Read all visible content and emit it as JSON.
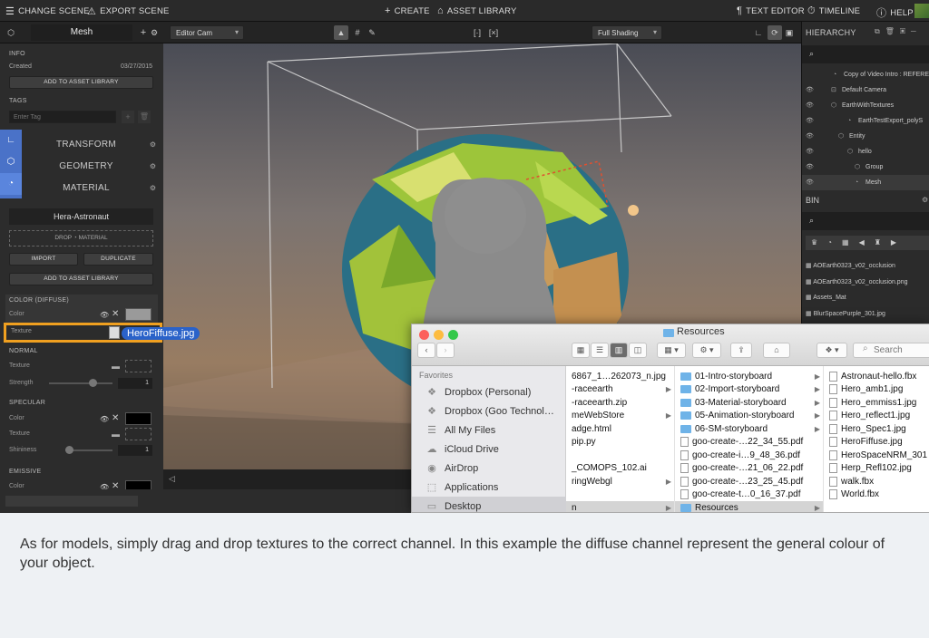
{
  "topbar": {
    "change_scene": "CHANGE SCENE",
    "export_scene": "EXPORT SCENE",
    "create": "CREATE",
    "asset_library": "ASSET LIBRARY",
    "text_editor": "TEXT EDITOR",
    "timeline": "TIMELINE",
    "help": "HELP"
  },
  "toolbar": {
    "entity_name": "Mesh",
    "camera_select": "Editor Cam",
    "shading_select": "Full Shading"
  },
  "inspector": {
    "info_title": "INFO",
    "created_label": "Created",
    "created_value": "03/27/2015",
    "add_asset_label": "ADD TO ASSET LIBRARY",
    "tags_title": "TAGS",
    "tag_placeholder": "Enter Tag",
    "transform": "TRANSFORM",
    "geometry": "GEOMETRY",
    "material": "MATERIAL",
    "material_name": "Hera-Astronaut",
    "drop_material": "DROP",
    "drop_material_suffix": "MATERIAL",
    "import": "IMPORT",
    "duplicate": "DUPLICATE",
    "add_asset_label2": "ADD TO ASSET LIBRARY",
    "color_diffuse": "COLOR (DIFFUSE)",
    "color": "Color",
    "texture": "Texture",
    "normal": "NORMAL",
    "normal_texture": "Texture",
    "strength": "Strength",
    "strength_value": "1",
    "specular": "SPECULAR",
    "spec_color": "Color",
    "spec_texture": "Texture",
    "shininess": "Shininess",
    "shininess_value": "1",
    "emissive": "EMISSIVE",
    "emissive_color": "Color"
  },
  "drag": {
    "file": "HeroFiffuse.jpg"
  },
  "hierarchy": {
    "title": "HIERARCHY",
    "items": [
      "Copy of Video Intro : REFERE",
      "Default Camera",
      "EarthWithTextures",
      "EarthTestExport_polyS",
      "Entity",
      "hello",
      "Group",
      "Mesh"
    ]
  },
  "bin": {
    "title": "BIN",
    "items": [
      "AOEarth0323_v02_occlusion",
      "AOEarth0323_v02_occlusion.png",
      "Assets_Mat",
      "BlurSpacePurple_301.jpg"
    ]
  },
  "finder": {
    "title": "Resources",
    "search_placeholder": "Search",
    "favorites_title": "Favorites",
    "sidebar": [
      "Dropbox (Personal)",
      "Dropbox (Goo Technol…",
      "All My Files",
      "iCloud Drive",
      "AirDrop",
      "Applications",
      "Desktop"
    ],
    "col1": [
      "6867_1…262073_n.jpg",
      "-raceearth",
      "-raceearth.zip",
      "meWebStore",
      "adge.html",
      "pip.py",
      "",
      "_COMOPS_102.ai",
      "ringWebgl",
      "",
      "n"
    ],
    "col2": [
      "01-Intro-storyboard",
      "02-Import-storyboard",
      "03-Material-storyboard",
      "05-Animation-storyboard",
      "06-SM-storyboard",
      "goo-create-…22_34_55.pdf",
      "goo-create-i…9_48_36.pdf",
      "goo-create-…21_06_22.pdf",
      "goo-create-…23_25_45.pdf",
      "goo-create-t…0_16_37.pdf",
      "Resources"
    ],
    "col3": [
      "Astronaut-hello.fbx",
      "Hero_amb1.jpg",
      "Hero_emmiss1.jpg",
      "Hero_reflect1.jpg",
      "Hero_Spec1.jpg",
      "HeroFiffuse.jpg",
      "HeroSpaceNRM_301",
      "Herp_Refl102.jpg",
      "walk.fbx",
      "World.fbx"
    ]
  },
  "caption": "As for models, simply drag and drop textures to the correct channel. In this example the diffuse channel represent the general colour of your object."
}
